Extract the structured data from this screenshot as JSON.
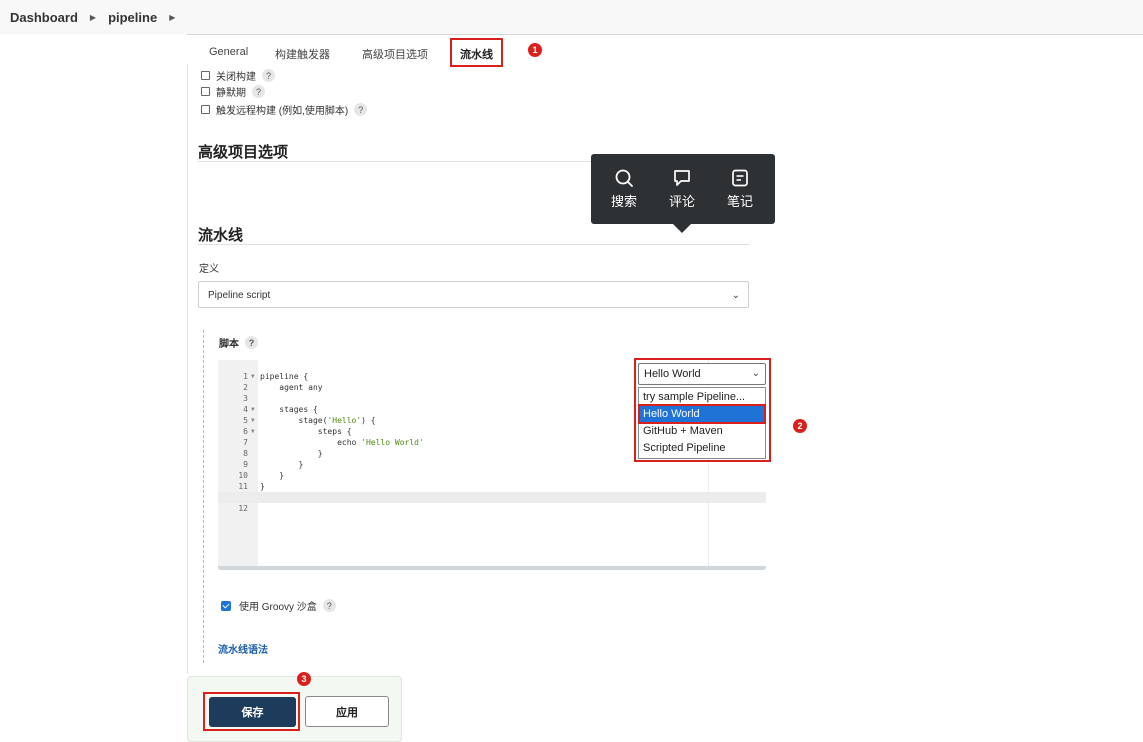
{
  "breadcrumb": [
    {
      "label": "Dashboard"
    },
    {
      "label": "pipeline"
    }
  ],
  "tabs": [
    {
      "label": "General"
    },
    {
      "label": "构建触发器"
    },
    {
      "label": "高级项目选项"
    },
    {
      "label": "流水线"
    }
  ],
  "annotations": [
    "1",
    "2",
    "3"
  ],
  "options": [
    {
      "label": "关闭构建",
      "checked": false
    },
    {
      "label": "静默期",
      "checked": false
    },
    {
      "label": "触发远程构建 (例如,使用脚本)",
      "checked": false
    }
  ],
  "help_glyph": "?",
  "sections": {
    "advanced_title": "高级项目选项",
    "pipeline_title": "流水线"
  },
  "popup": {
    "items": [
      {
        "label": "搜索",
        "icon": "search-icon"
      },
      {
        "label": "评论",
        "icon": "comment-icon"
      },
      {
        "label": "笔记",
        "icon": "note-icon"
      }
    ]
  },
  "definition": {
    "label": "定义",
    "value": "Pipeline script"
  },
  "script": {
    "label": "脚本",
    "lines": [
      {
        "n": "1",
        "fold": true,
        "code": "pipeline {",
        "str": ""
      },
      {
        "n": "2",
        "fold": false,
        "code": "    agent any",
        "str": ""
      },
      {
        "n": "3",
        "fold": false,
        "code": "",
        "str": ""
      },
      {
        "n": "4",
        "fold": true,
        "code": "    stages {",
        "str": ""
      },
      {
        "n": "5",
        "fold": true,
        "code": "        stage(",
        "str": "'Hello'",
        "after": ") {"
      },
      {
        "n": "6",
        "fold": true,
        "code": "            steps {",
        "str": ""
      },
      {
        "n": "7",
        "fold": false,
        "code": "                echo ",
        "str": "'Hello World'"
      },
      {
        "n": "8",
        "fold": false,
        "code": "            }",
        "str": ""
      },
      {
        "n": "9",
        "fold": false,
        "code": "        }",
        "str": ""
      },
      {
        "n": "10",
        "fold": false,
        "code": "    }",
        "str": ""
      },
      {
        "n": "11",
        "fold": false,
        "code": "}",
        "str": ""
      },
      {
        "n": "12",
        "fold": false,
        "code": "",
        "str": ""
      }
    ]
  },
  "sample": {
    "selected": "Hello World",
    "options": [
      "try sample Pipeline...",
      "Hello World",
      "GitHub + Maven",
      "Scripted Pipeline"
    ],
    "highlighted": "Hello World"
  },
  "groovy": {
    "label": "使用 Groovy 沙盒",
    "checked": true
  },
  "syntax_link": "流水线语法",
  "buttons": {
    "save": "保存",
    "apply": "应用"
  },
  "colors": {
    "annotation_red": "#d9201d",
    "selected_option": "#1f73d6",
    "save_button": "#1d3b5a",
    "link": "#1c5fa8"
  }
}
